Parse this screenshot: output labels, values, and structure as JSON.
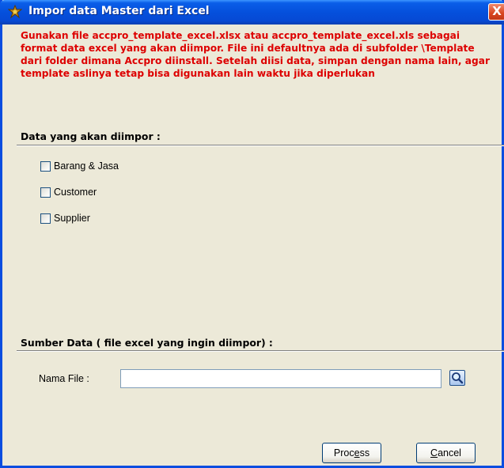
{
  "window": {
    "title": "Impor data Master dari Excel",
    "close_glyph": "X"
  },
  "notice": "Gunakan file accpro_template_excel.xlsx atau accpro_template_excel.xls sebagai format data excel yang akan diimpor. File ini defaultnya ada di subfolder \\Template dari folder dimana Accpro diinstall. Setelah diisi data, simpan dengan nama lain, agar template aslinya tetap bisa digunakan lain waktu jika diperlukan",
  "import_section": {
    "label": "Data yang akan diimpor :",
    "options": [
      {
        "label": "Barang & Jasa",
        "checked": false
      },
      {
        "label": "Customer",
        "checked": false
      },
      {
        "label": "Supplier",
        "checked": false
      }
    ]
  },
  "source_section": {
    "label": "Sumber Data ( file excel yang ingin diimpor) :",
    "file_label": "Nama File :",
    "file_value": ""
  },
  "buttons": {
    "process_pre": "Proc",
    "process_key": "e",
    "process_post": "ss",
    "cancel_key": "C",
    "cancel_post": "ancel"
  },
  "colors": {
    "notice": "#dd0000",
    "titlebar": "#0550dc",
    "window_bg": "#ece9d8"
  },
  "icons": {
    "app": "app-icon",
    "close": "close-icon",
    "browse": "magnifier-icon"
  }
}
